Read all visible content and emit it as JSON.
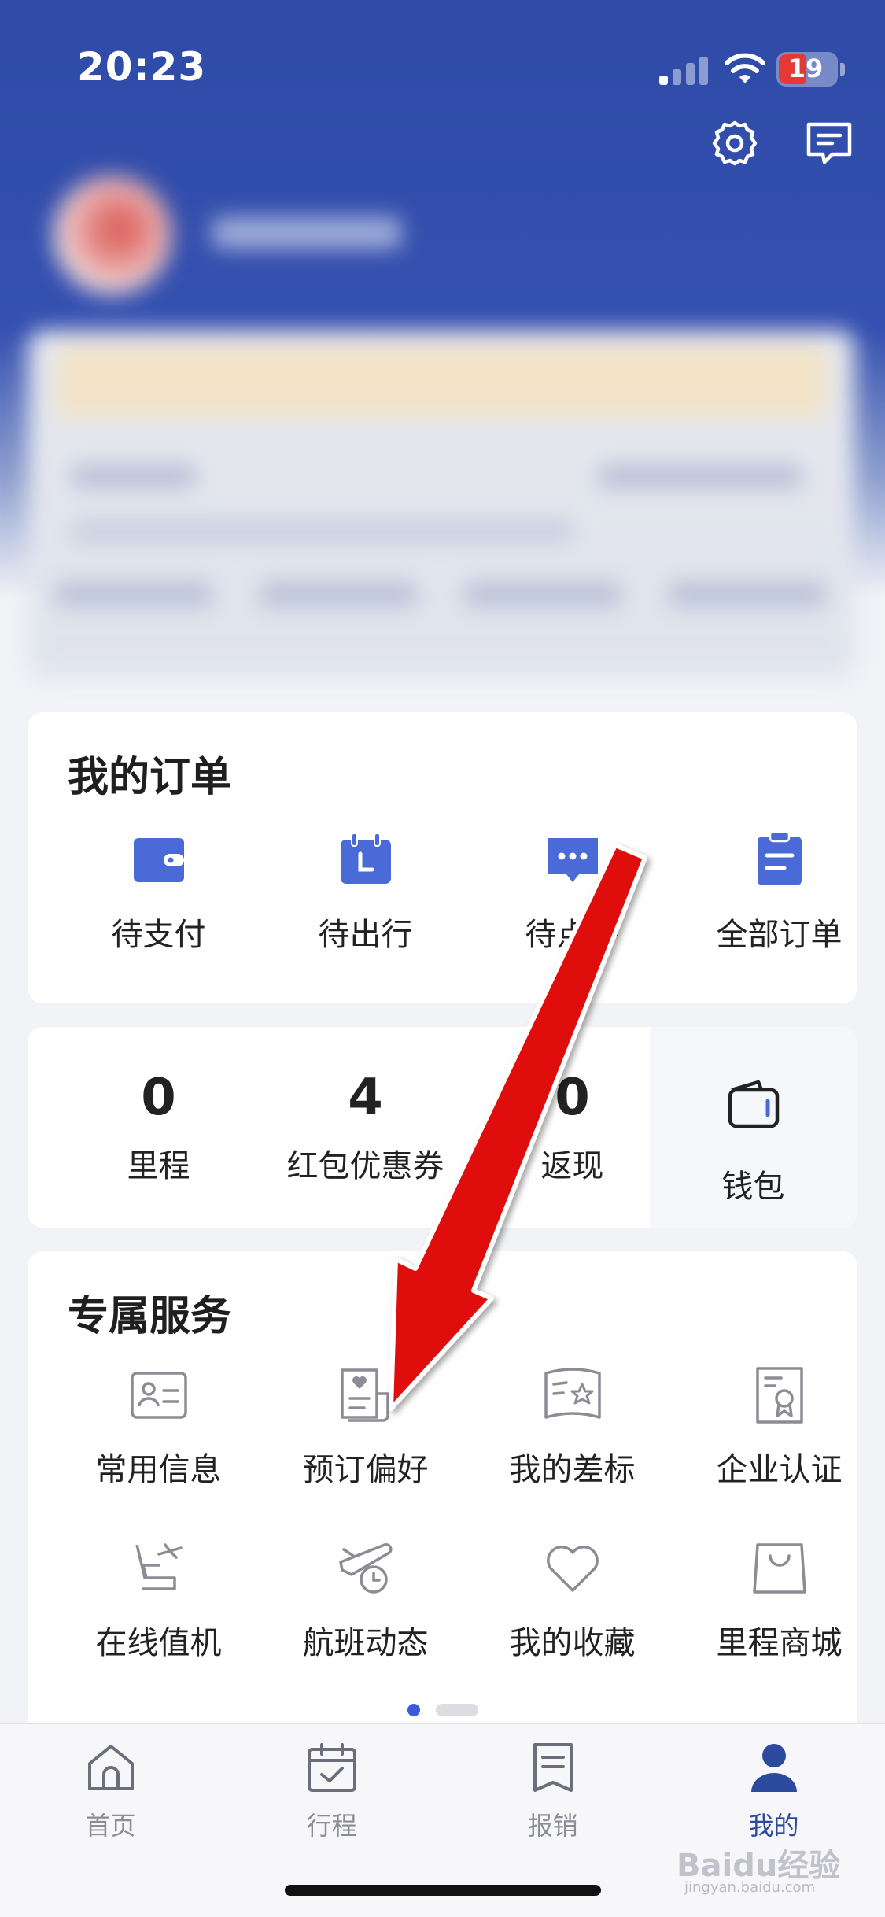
{
  "status_bar": {
    "time": "20:23",
    "battery": "19"
  },
  "header": {
    "settings_icon": "gear-icon",
    "message_icon": "chat-icon"
  },
  "orders": {
    "title": "我的订单",
    "items": [
      {
        "label": "待支付",
        "icon": "wallet-card-icon"
      },
      {
        "label": "待出行",
        "icon": "calendar-icon"
      },
      {
        "label": "待点评",
        "icon": "comment-icon"
      },
      {
        "label": "全部订单",
        "icon": "clipboard-icon"
      }
    ]
  },
  "stats": {
    "items": [
      {
        "value": "0",
        "label": "里程"
      },
      {
        "value": "4",
        "label": "红包优惠券"
      },
      {
        "value": "0",
        "label": "返现"
      }
    ],
    "wallet": {
      "label": "钱包",
      "icon": "wallet-icon"
    }
  },
  "services": {
    "title": "专属服务",
    "items": [
      {
        "label": "常用信息",
        "icon": "id-card-icon"
      },
      {
        "label": "预订偏好",
        "icon": "preference-doc-icon"
      },
      {
        "label": "我的差标",
        "icon": "standard-book-icon"
      },
      {
        "label": "企业认证",
        "icon": "certificate-icon"
      },
      {
        "label": "在线值机",
        "icon": "seat-checkin-icon"
      },
      {
        "label": "航班动态",
        "icon": "flight-status-icon"
      },
      {
        "label": "我的收藏",
        "icon": "heart-icon"
      },
      {
        "label": "里程商城",
        "icon": "shopping-bag-icon"
      }
    ]
  },
  "tabs": [
    {
      "label": "首页",
      "icon": "home-icon"
    },
    {
      "label": "行程",
      "icon": "calendar-check-icon"
    },
    {
      "label": "报销",
      "icon": "receipt-icon"
    },
    {
      "label": "我的",
      "icon": "user-icon",
      "active": true
    }
  ],
  "watermark": {
    "text": "Baidu经验",
    "sub": "jingyan.baidu.com"
  },
  "colors": {
    "brand": "#2f4ba7",
    "accent": "#4a6ad8",
    "arrow": "#e01010"
  }
}
